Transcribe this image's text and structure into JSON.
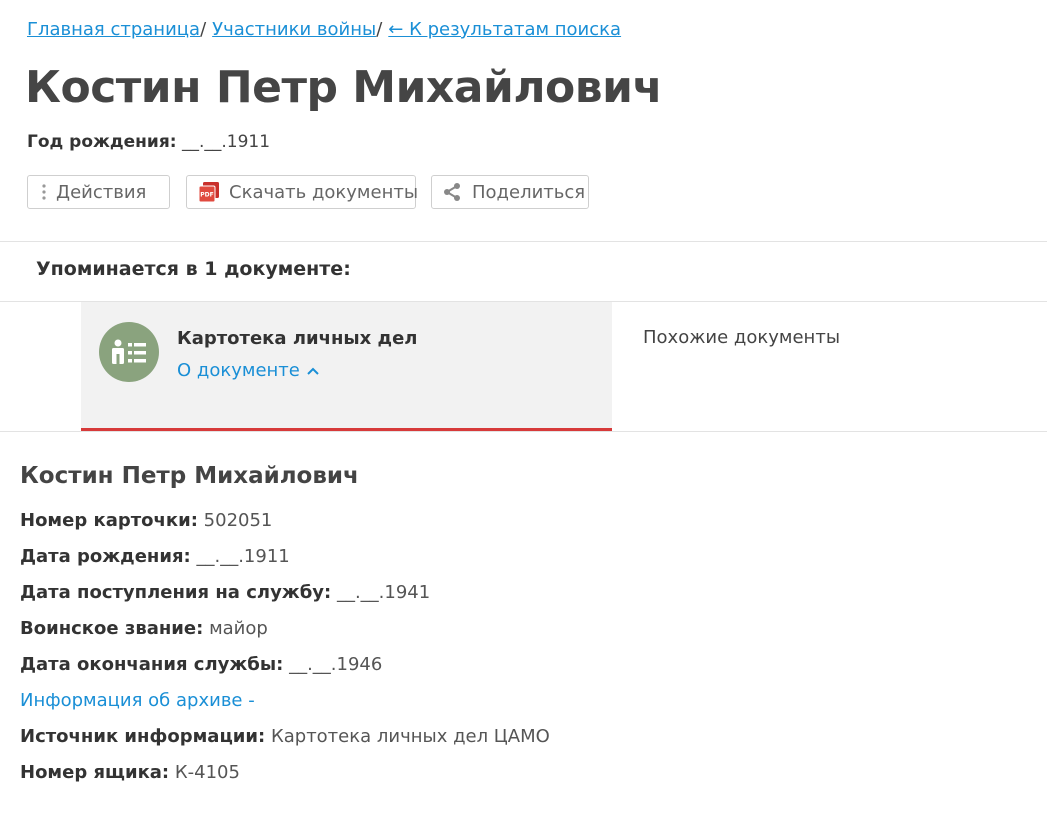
{
  "breadcrumb": {
    "home": "Главная страница",
    "participants": "Участники войны",
    "back": "← К результатам поиска",
    "separator": "/"
  },
  "person": {
    "name": "Костин Петр Михайлович",
    "birth_label": "Год рождения:",
    "birth_value": "__.__.1911"
  },
  "toolbar": {
    "actions_label": "Действия",
    "download_label": "Скачать документы",
    "share_label": "Поделиться"
  },
  "mentions": {
    "title": "Упоминается в 1 документе:"
  },
  "document_tab": {
    "name": "Картотека личных дел",
    "about_label": "О документе",
    "similar_label": "Похожие документы"
  },
  "card": {
    "name": "Костин Петр Михайлович",
    "fields": [
      {
        "label": "Номер карточки:",
        "value": "502051"
      },
      {
        "label": "Дата рождения:",
        "value": "__.__.1911"
      },
      {
        "label": "Дата поступления на службу:",
        "value": "__.__.1941"
      },
      {
        "label": "Воинское звание:",
        "value": "майор"
      },
      {
        "label": "Дата окончания службы:",
        "value": "__.__.1946"
      }
    ],
    "archive_link": "Информация об архиве -",
    "fields_after": [
      {
        "label": "Источник информации:",
        "value": "Картотека личных дел ЦАМО"
      },
      {
        "label": "Номер ящика:",
        "value": "К-4105"
      }
    ]
  },
  "colors": {
    "link": "#1a8fd6",
    "accent_red": "#d73a3a",
    "avatar_green": "#8aa37e",
    "tab_bg": "#f2f2f2"
  },
  "icons": {
    "actions": "kebab-icon",
    "download": "pdf-icon",
    "share": "share-icon",
    "document": "personnel-card-icon",
    "about_toggle": "chevron-up-icon"
  }
}
